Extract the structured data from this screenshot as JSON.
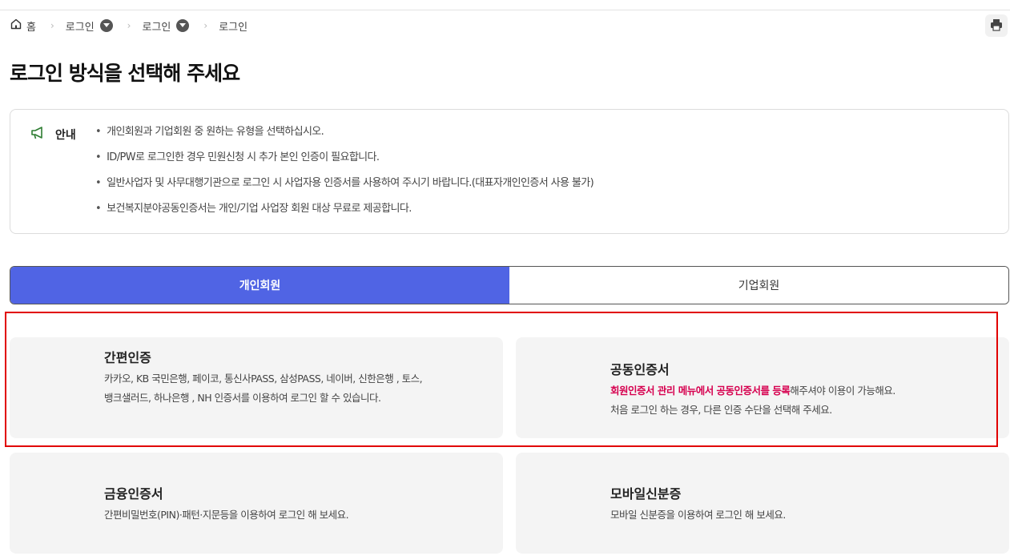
{
  "breadcrumb": {
    "home": "홈",
    "items": [
      "로그인",
      "로그인",
      "로그인"
    ]
  },
  "page_title": "로그인 방식을 선택해 주세요",
  "notice": {
    "title": "안내",
    "items": [
      "개인회원과 기업회원 중 원하는 유형을 선택하십시오.",
      "ID/PW로 로그인한 경우 민원신청 시 추가 본인 인증이 필요합니다.",
      "일반사업자 및 사무대행기관으로 로그인 시 사업자용 인증서를 사용하여 주시기 바랍니다.(대표자개인인증서 사용 불가)",
      "보건복지분야공동인증서는 개인/기업 사업장 회원 대상 무료로 제공합니다."
    ]
  },
  "tabs": {
    "personal": "개인회원",
    "business": "기업회원"
  },
  "cards": {
    "simple": {
      "title": "간편인증",
      "line1": "카카오, KB 국민은행, 페이코, 통신사PASS, 삼성PASS, 네이버, 신한은행 , 토스,",
      "line2": "뱅크샐러드, 하나은행 , NH 인증서를 이용하여 로그인 할 수 있습니다."
    },
    "joint": {
      "title": "공동인증서",
      "line1_emph": "회원인증서 관리 메뉴에서 공동인증서를 등록",
      "line1_rest": "해주셔야 이용이 가능해요.",
      "line2": "처음 로그인 하는 경우, 다른 인증 수단을 선택해 주세요."
    },
    "financial": {
      "title": "금융인증서",
      "line1": "간편비밀번호(PIN)·패턴·지문등을 이용하여 로그인 해 보세요."
    },
    "mobile": {
      "title": "모바일신분증",
      "line1": "모바일 신분증을 이용하여 로그인 해 보세요."
    }
  },
  "colors": {
    "tab_active": "#5064e4",
    "highlight_border": "#e10000",
    "emphasis_text": "#d6004f",
    "notice_icon": "#2e7d32"
  }
}
